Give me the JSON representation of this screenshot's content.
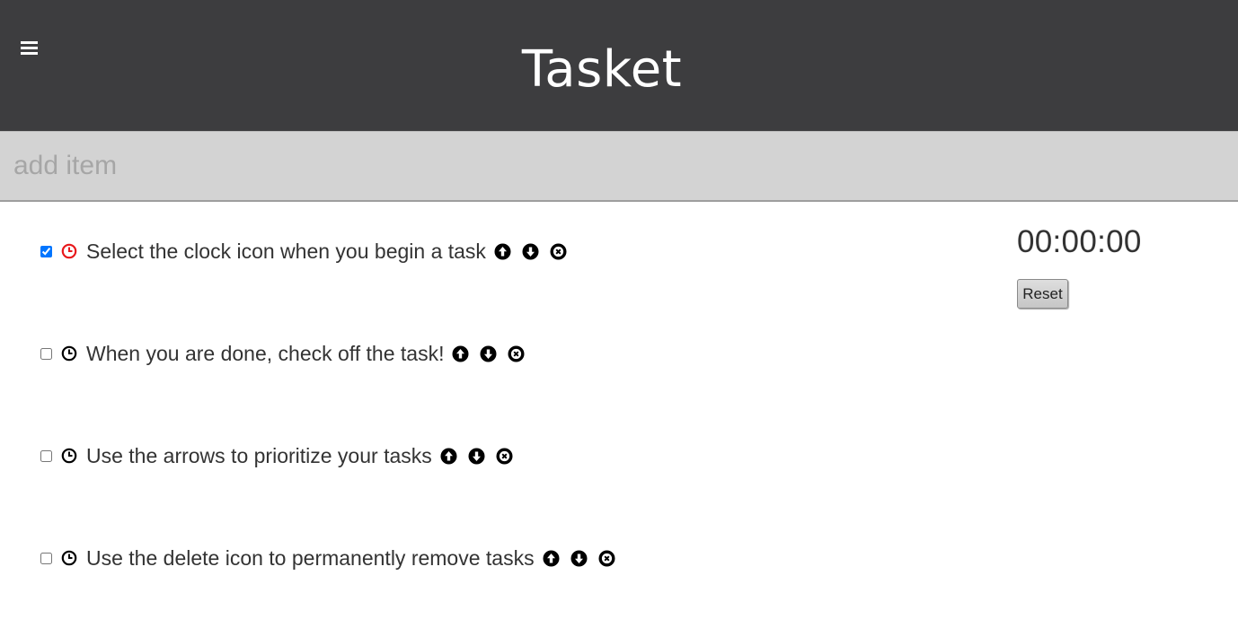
{
  "header": {
    "title": "Tasket",
    "menu_icon": "hamburger-menu-icon",
    "background": "#3d3d3f"
  },
  "add_item": {
    "placeholder": "add item",
    "value": ""
  },
  "tasks": [
    {
      "label": "Select the clock icon when you begin a task",
      "checked": true,
      "timing": true
    },
    {
      "label": "When you are done, check off the task!",
      "checked": false,
      "timing": false
    },
    {
      "label": "Use the arrows to prioritize your tasks",
      "checked": false,
      "timing": false
    },
    {
      "label": "Use the delete icon to permanently remove tasks",
      "checked": false,
      "timing": false
    }
  ],
  "task_icons": {
    "clock": "clock-icon",
    "move_up": "arrow-up-icon",
    "move_down": "arrow-down-icon",
    "delete": "close-circle-icon"
  },
  "timer": {
    "display": "00:00:00",
    "reset_label": "Reset"
  },
  "colors": {
    "active_clock": "#e8191c",
    "icon": "#000000",
    "add_bar": "#d3d3d3"
  }
}
